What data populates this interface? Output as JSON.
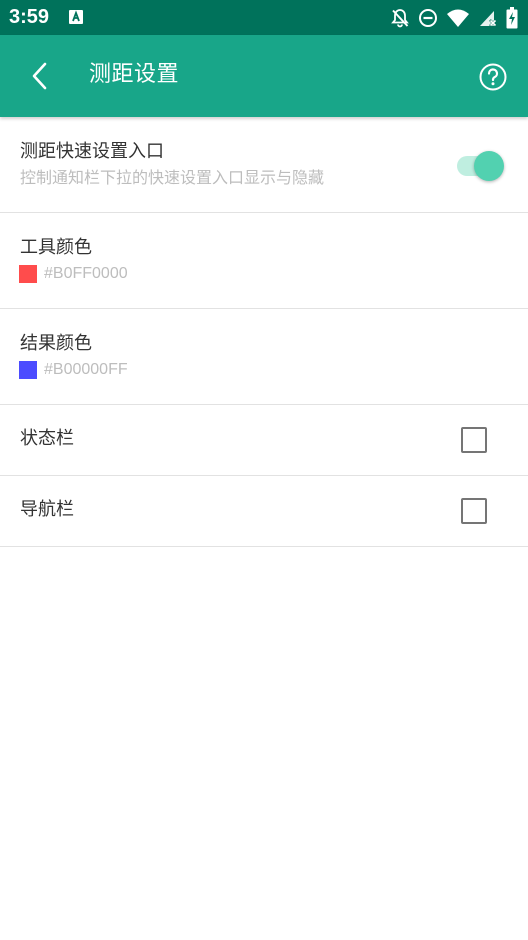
{
  "status_bar": {
    "time": "3:59"
  },
  "app_bar": {
    "title": "测距设置"
  },
  "colors": {
    "status_bar_bg": "#00725b",
    "app_bar_bg": "#18a689",
    "switch_thumb": "#52d1b0",
    "switch_track": "#bfeee0",
    "tool_color_swatch": "#ff4c4c",
    "result_color_swatch": "#4c4cff"
  },
  "settings": {
    "quick_entry": {
      "title": "测距快速设置入口",
      "subtitle": "控制通知栏下拉的快速设置入口显示与隐藏",
      "enabled": true
    },
    "tool_color": {
      "title": "工具颜色",
      "value": "#B0FF0000"
    },
    "result_color": {
      "title": "结果颜色",
      "value": "#B00000FF"
    },
    "status_bar_option": {
      "title": "状态栏",
      "checked": false
    },
    "nav_bar_option": {
      "title": "导航栏",
      "checked": false
    }
  }
}
